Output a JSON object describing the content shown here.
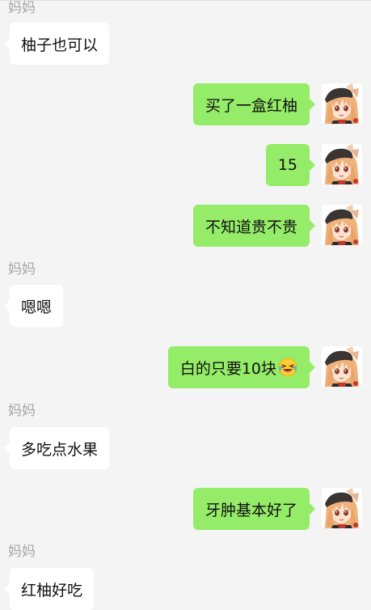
{
  "chat": {
    "sender_name": "妈妈",
    "messages": [
      {
        "side": "left",
        "text": "柚子也可以"
      },
      {
        "side": "right",
        "text": "买了一盒红柚"
      },
      {
        "side": "right",
        "text": "15"
      },
      {
        "side": "right",
        "text": "不知道贵不贵"
      },
      {
        "side": "left",
        "text": "嗯嗯"
      },
      {
        "side": "right",
        "text": "白的只要10块",
        "emoji": "laughing-crying-emoji"
      },
      {
        "side": "left",
        "text": "多吃点水果"
      },
      {
        "side": "right",
        "text": "牙肿基本好了"
      },
      {
        "side": "left",
        "text": "红柚好吃"
      }
    ]
  },
  "colors": {
    "background": "#f4f4f4",
    "outgoing_bubble": "#95ec69",
    "incoming_bubble": "#ffffff",
    "sender_name": "#a6a6a6"
  },
  "icons": {
    "avatar": "anime-girl-avatar",
    "emoji": "laughing-crying-emoji"
  }
}
